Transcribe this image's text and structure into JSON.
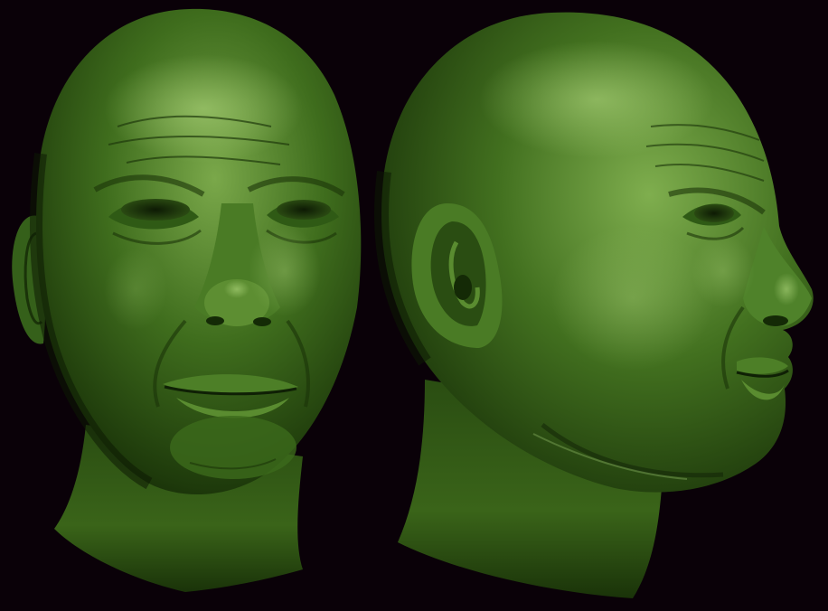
{
  "scene": {
    "description_visible_text": "",
    "background_color": "#0a0108",
    "material_base_color": "#3d6a1c",
    "material_shadow_color": "#142a06",
    "material_highlight_color": "#8ab85a",
    "views": [
      {
        "id": "front",
        "subject": "sculpted-male-head",
        "orientation": "front-three-quarter"
      },
      {
        "id": "profile",
        "subject": "sculpted-male-head",
        "orientation": "right-profile"
      }
    ]
  }
}
